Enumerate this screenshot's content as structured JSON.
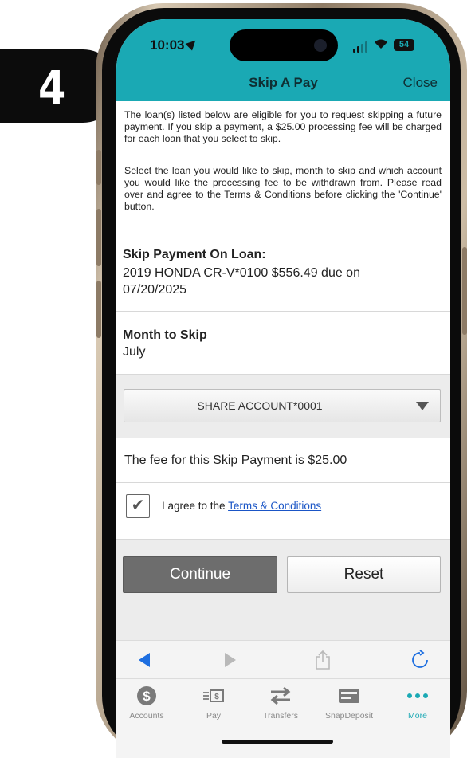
{
  "step_badge": {
    "number": "4"
  },
  "status_bar": {
    "time": "10:03",
    "battery": "54"
  },
  "navbar": {
    "title": "Skip A Pay",
    "close_label": "Close"
  },
  "intro": {
    "paragraph1": "The loan(s) listed below are eligible for you to request skipping a future payment. If you skip a payment, a $25.00 processing fee will be charged for each loan that you select to skip.",
    "paragraph2": "Select the loan you would like to skip, month to skip and which account you would like the processing fee to be withdrawn from. Please read over and agree to the Terms & Conditions before clicking the 'Continue' button."
  },
  "loan": {
    "label": "Skip Payment On Loan:",
    "value": "2019 HONDA CR-V*0100 $556.49 due on 07/20/2025"
  },
  "month": {
    "label": "Month to Skip",
    "value": "July"
  },
  "account_select": {
    "selected": "SHARE ACCOUNT*0001"
  },
  "fee": {
    "text": "The fee for this Skip Payment is $25.00"
  },
  "agree": {
    "checked": true,
    "prefix": "I agree to the ",
    "link": "Terms & Conditions"
  },
  "buttons": {
    "continue": "Continue",
    "reset": "Reset"
  },
  "browser_toolbar": {
    "icons": [
      "back-arrow-icon",
      "forward-arrow-icon",
      "share-icon",
      "reload-icon"
    ]
  },
  "tabbar": {
    "items": [
      {
        "label": "Accounts",
        "icon": "dollar-circle-icon"
      },
      {
        "label": "Pay",
        "icon": "bill-icon"
      },
      {
        "label": "Transfers",
        "icon": "transfer-arrows-icon"
      },
      {
        "label": "SnapDeposit",
        "icon": "check-card-icon"
      },
      {
        "label": "More",
        "icon": "more-dots-icon",
        "active": true
      }
    ]
  },
  "colors": {
    "accent": "#1aa9b4",
    "link": "#1a55c6",
    "continue_button": "#6d6d6d"
  }
}
